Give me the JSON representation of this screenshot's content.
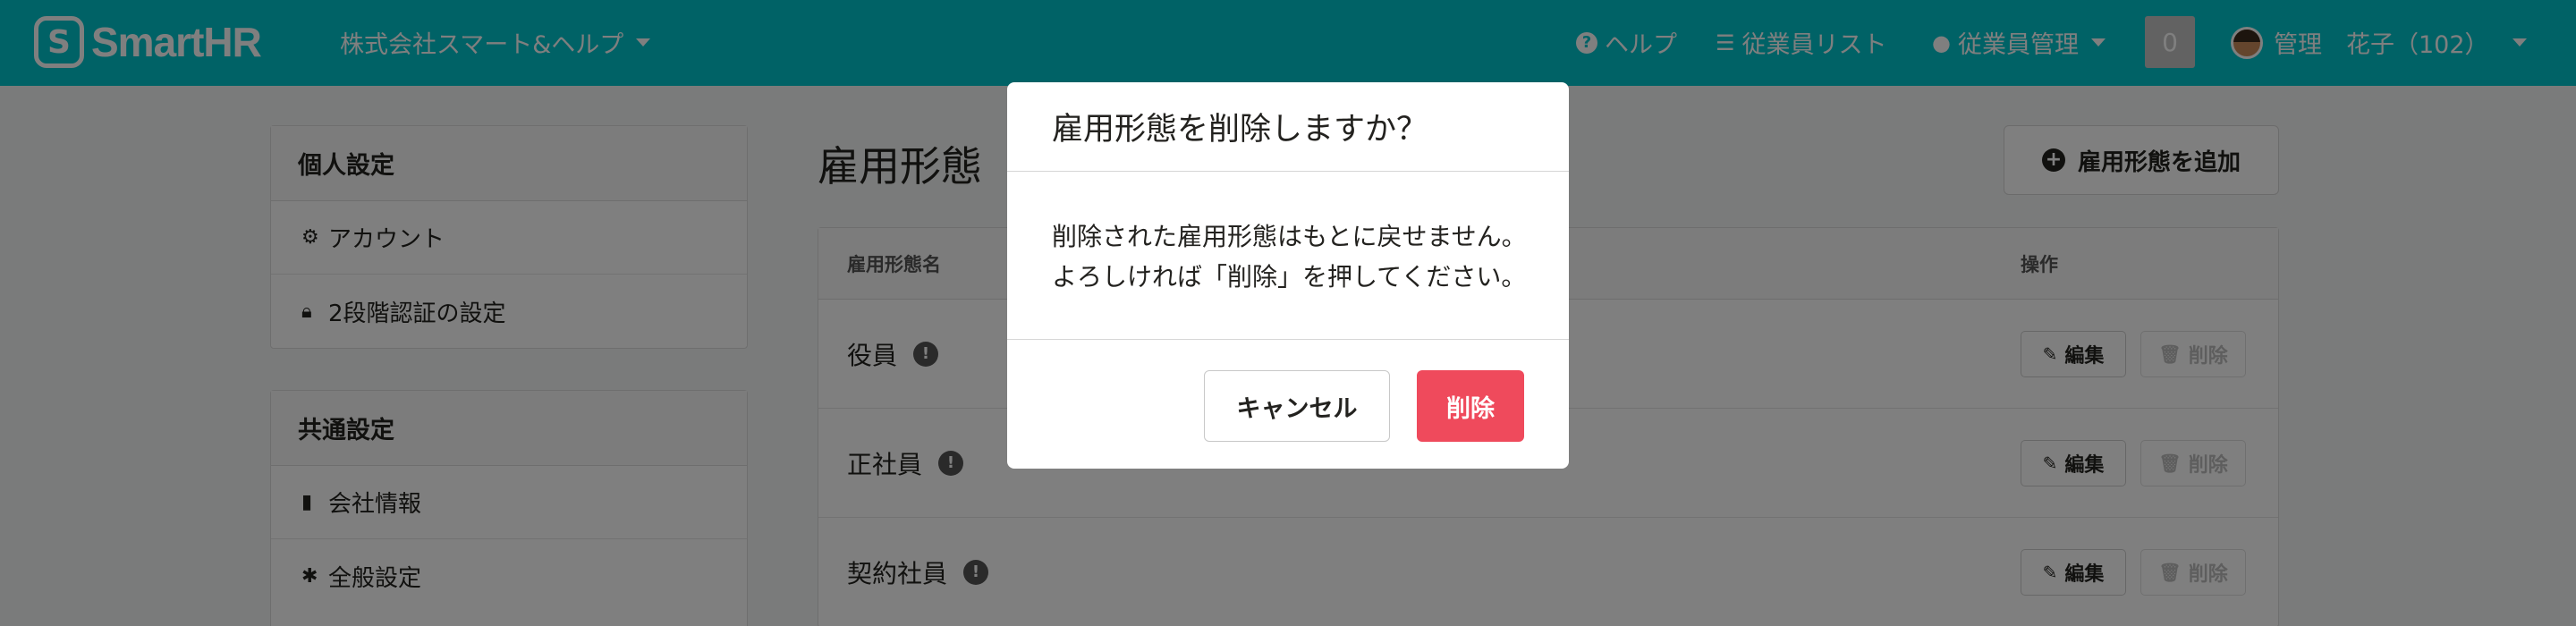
{
  "header": {
    "logo_text": "SmartHR",
    "company": "株式会社スマート&ヘルプ",
    "help": "ヘルプ",
    "employee_list": "従業員リスト",
    "employee_manage": "従業員管理",
    "notifications": "0",
    "user": "管理　花子（102）",
    "accent_color": "#00c4cc"
  },
  "sidebar": {
    "personal": {
      "title": "個人設定",
      "items": [
        {
          "icon": "gear-icon",
          "label": "アカウント"
        },
        {
          "icon": "lock-icon",
          "label": "2段階認証の設定"
        }
      ]
    },
    "common": {
      "title": "共通設定",
      "items": [
        {
          "icon": "building-icon",
          "label": "会社情報"
        },
        {
          "icon": "asterisk-icon",
          "label": "全般設定"
        }
      ]
    }
  },
  "main": {
    "title": "雇用形態",
    "add_button": "雇用形態を追加",
    "table": {
      "headers": {
        "name": "雇用形態名",
        "ops": "操作"
      },
      "rows": [
        {
          "name": "役員",
          "edit": "編集",
          "delete": "削除"
        },
        {
          "name": "正社員",
          "edit": "編集",
          "delete": "削除"
        },
        {
          "name": "契約社員",
          "edit": "編集",
          "delete": "削除"
        }
      ]
    }
  },
  "dialog": {
    "title": "雇用形態を削除しますか？",
    "body_line1": "削除された雇用形態はもとに戻せません。",
    "body_line2": "よろしければ「削除」を押してください。",
    "cancel": "キャンセル",
    "delete": "削除",
    "danger_color": "#ef4a5c"
  }
}
